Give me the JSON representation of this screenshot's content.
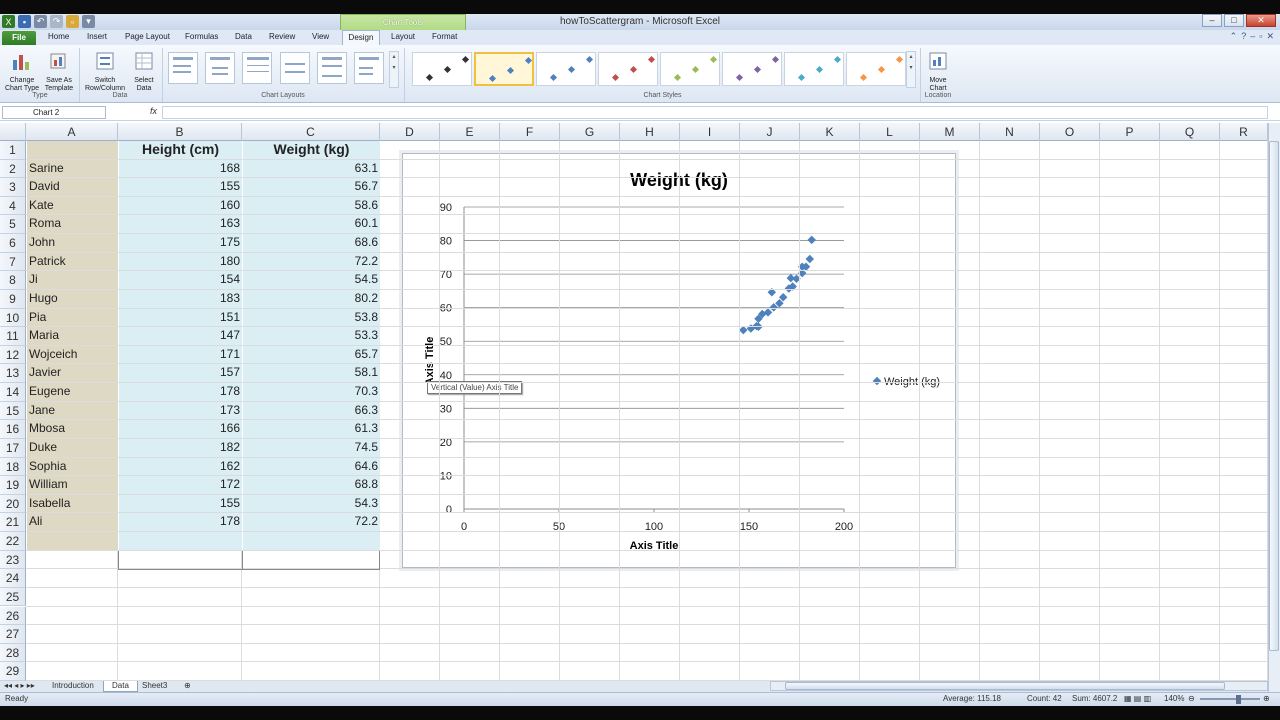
{
  "window": {
    "title": "howToScattergram - Microsoft Excel",
    "context_tab": "Chart Tools"
  },
  "ribbon": {
    "tabs": [
      "File",
      "Home",
      "Insert",
      "Page Layout",
      "Formulas",
      "Data",
      "Review",
      "View",
      "Design",
      "Layout",
      "Format"
    ],
    "active_tab": "Design",
    "buttons": {
      "change_chart_type": "Change Chart Type",
      "save_as_template": "Save As Template",
      "switch_row_column": "Switch Row/Column",
      "select_data": "Select Data",
      "move_chart": "Move Chart"
    },
    "groups": {
      "type": "Type",
      "data": "Data",
      "chart_layouts": "Chart Layouts",
      "chart_styles": "Chart Styles",
      "location": "Location"
    },
    "style_colors": [
      "#333333",
      "#4f81bd",
      "#4f81bd",
      "#c0504d",
      "#9bbb59",
      "#8064a2",
      "#4bacc6",
      "#f79646"
    ]
  },
  "formula_bar": {
    "name_box": "Chart 2",
    "fx": "fx",
    "formula": ""
  },
  "columns": [
    "A",
    "B",
    "C",
    "D",
    "E",
    "F",
    "G",
    "H",
    "I",
    "J",
    "K",
    "L",
    "M",
    "N",
    "O",
    "P",
    "Q",
    "R"
  ],
  "rows": [
    "1",
    "2",
    "3",
    "4",
    "5",
    "6",
    "7",
    "8",
    "9",
    "10",
    "11",
    "12",
    "13",
    "14",
    "15",
    "16",
    "17",
    "18",
    "19",
    "20",
    "21",
    "22",
    "23",
    "24",
    "25",
    "26",
    "27",
    "28",
    "29"
  ],
  "table": {
    "headers": [
      "Height (cm)",
      "Weight (kg)"
    ],
    "rows": [
      {
        "name": "Sarine",
        "height": "168",
        "weight": "63.1"
      },
      {
        "name": "David",
        "height": "155",
        "weight": "56.7"
      },
      {
        "name": "Kate",
        "height": "160",
        "weight": "58.6"
      },
      {
        "name": "Roma",
        "height": "163",
        "weight": "60.1"
      },
      {
        "name": "John",
        "height": "175",
        "weight": "68.6"
      },
      {
        "name": "Patrick",
        "height": "180",
        "weight": "72.2"
      },
      {
        "name": "Ji",
        "height": "154",
        "weight": "54.5"
      },
      {
        "name": "Hugo",
        "height": "183",
        "weight": "80.2"
      },
      {
        "name": "Pia",
        "height": "151",
        "weight": "53.8"
      },
      {
        "name": "Maria",
        "height": "147",
        "weight": "53.3"
      },
      {
        "name": "Wojceich",
        "height": "171",
        "weight": "65.7"
      },
      {
        "name": "Javier",
        "height": "157",
        "weight": "58.1"
      },
      {
        "name": "Eugene",
        "height": "178",
        "weight": "70.3"
      },
      {
        "name": "Jane",
        "height": "173",
        "weight": "66.3"
      },
      {
        "name": "Mbosa",
        "height": "166",
        "weight": "61.3"
      },
      {
        "name": "Duke",
        "height": "182",
        "weight": "74.5"
      },
      {
        "name": "Sophia",
        "height": "162",
        "weight": "64.6"
      },
      {
        "name": "William",
        "height": "172",
        "weight": "68.8"
      },
      {
        "name": "Isabella",
        "height": "155",
        "weight": "54.3"
      },
      {
        "name": "Ali",
        "height": "178",
        "weight": "72.2"
      }
    ]
  },
  "chart_data": {
    "type": "scatter",
    "title": "Weight (kg)",
    "xlabel": "Axis Title",
    "ylabel": "Axis Title",
    "xlim": [
      0,
      200
    ],
    "ylim": [
      0,
      90
    ],
    "x_ticks": [
      0,
      50,
      100,
      150,
      200
    ],
    "y_ticks": [
      0,
      10,
      20,
      30,
      40,
      50,
      60,
      70,
      80,
      90
    ],
    "grid": "horizontal",
    "legend": "right",
    "series": [
      {
        "name": "Weight (kg)",
        "color": "#4f81bd",
        "x": [
          168,
          155,
          160,
          163,
          175,
          180,
          154,
          183,
          151,
          147,
          171,
          157,
          178,
          173,
          166,
          182,
          162,
          172,
          155,
          178
        ],
        "y": [
          63.1,
          56.7,
          58.6,
          60.1,
          68.6,
          72.2,
          54.5,
          80.2,
          53.8,
          53.3,
          65.7,
          58.1,
          70.3,
          66.3,
          61.3,
          74.5,
          64.6,
          68.8,
          54.3,
          72.2
        ]
      }
    ]
  },
  "tooltip": "Vertical (Value) Axis Title",
  "sheets": {
    "tabs": [
      "Introduction",
      "Data",
      "Sheet3"
    ],
    "active": "Data"
  },
  "status": {
    "ready": "Ready",
    "average": "Average: 115.18",
    "count": "Count: 42",
    "sum": "Sum: 4607.2",
    "zoom": "140%"
  }
}
